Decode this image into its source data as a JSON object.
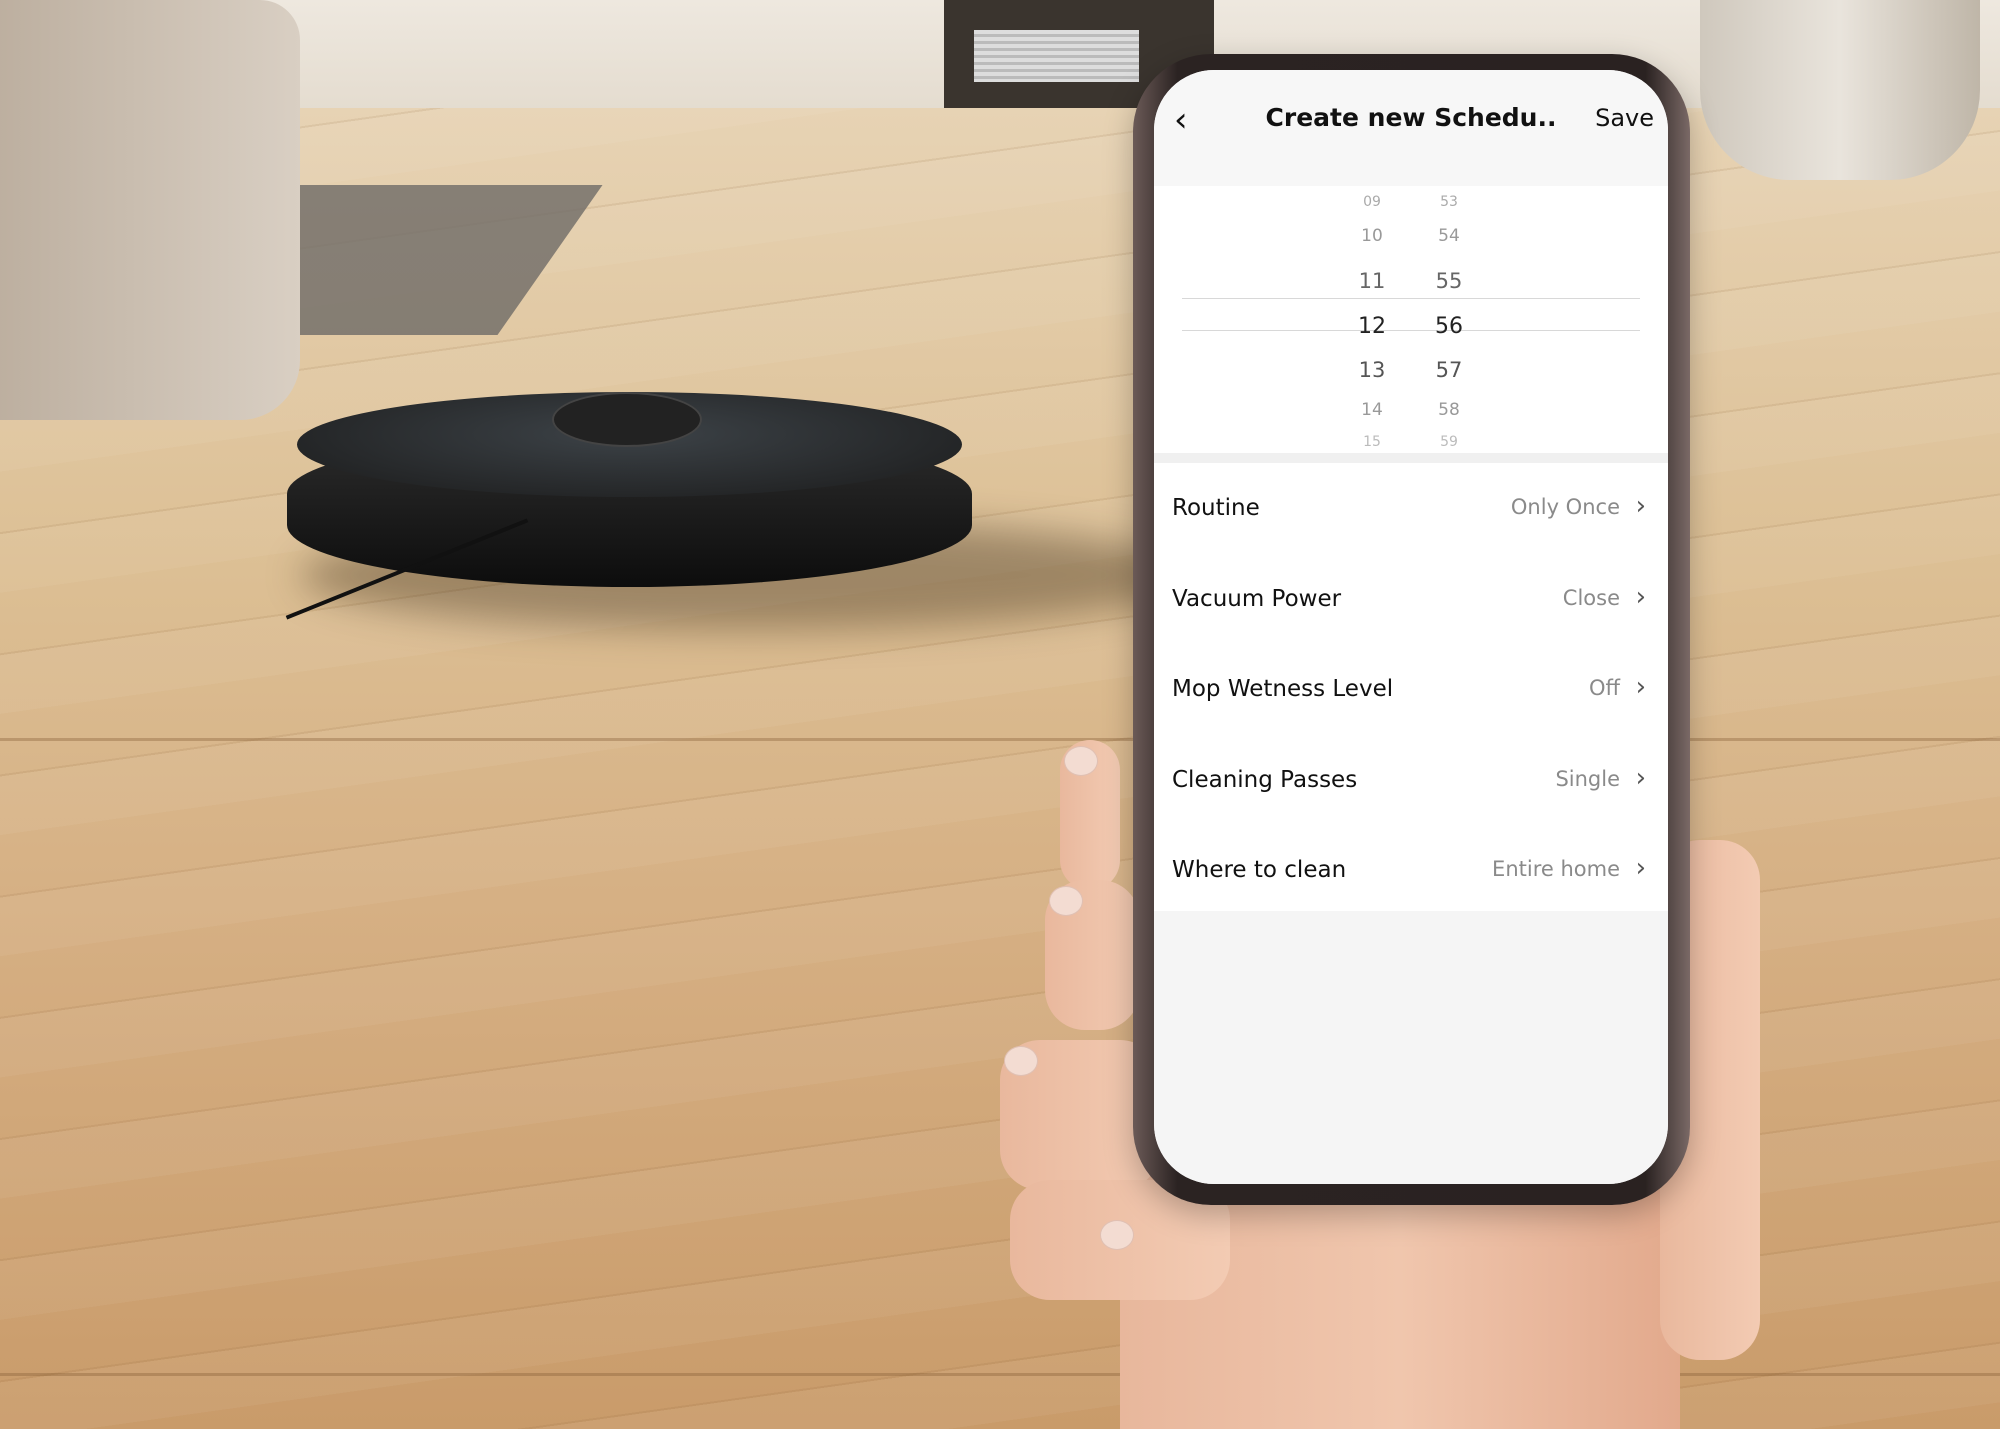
{
  "header": {
    "back_icon": "chevron-left-icon",
    "title": "Create new Schedu..",
    "save_label": "Save"
  },
  "time_picker": {
    "hours": [
      "09",
      "10",
      "11",
      "12",
      "13",
      "14",
      "15"
    ],
    "minutes": [
      "53",
      "54",
      "55",
      "56",
      "57",
      "58",
      "59"
    ],
    "selected_hour": "12",
    "selected_minute": "56"
  },
  "settings": [
    {
      "label": "Routine",
      "value": "Only Once"
    },
    {
      "label": "Vacuum Power",
      "value": "Close"
    },
    {
      "label": "Mop Wetness Level",
      "value": "Off"
    },
    {
      "label": "Cleaning Passes",
      "value": "Single"
    },
    {
      "label": "Where to clean",
      "value": "Entire home"
    }
  ]
}
